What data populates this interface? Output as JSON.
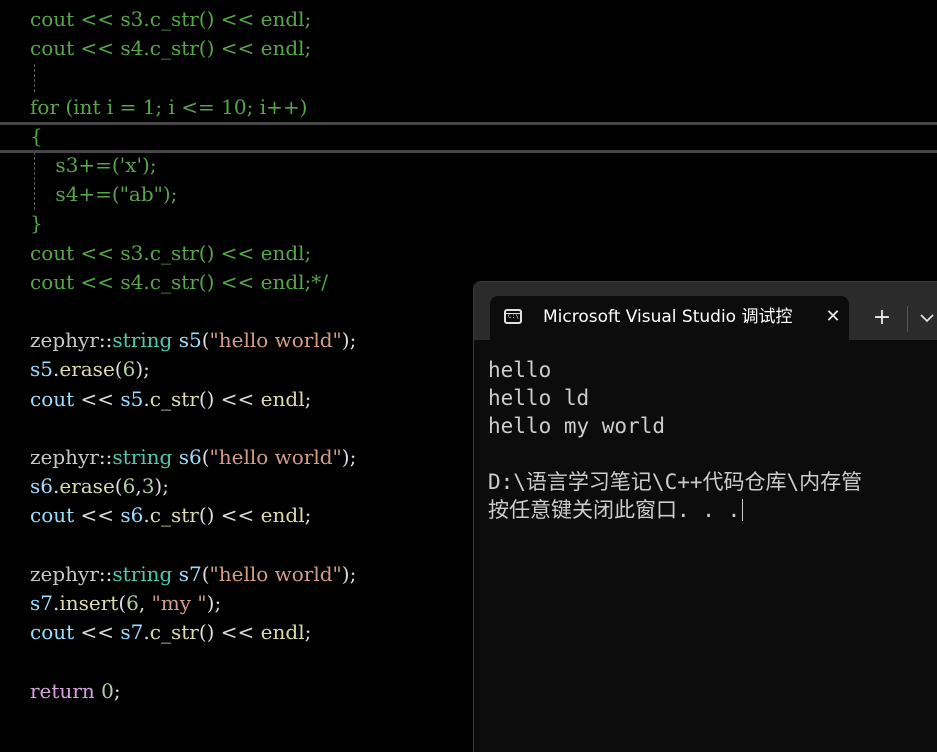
{
  "editor": {
    "lines": [
      {
        "segments": [
          {
            "text": "cout << s3.c_str() << endl;",
            "cls": ""
          }
        ]
      },
      {
        "segments": [
          {
            "text": "cout << s4.c_str() << endl;",
            "cls": ""
          }
        ]
      },
      {
        "segments": [
          {
            "text": "",
            "cls": ""
          }
        ]
      },
      {
        "segments": [
          {
            "text": "for (int i = 1; i <= 10; i++)",
            "cls": ""
          }
        ]
      },
      {
        "segments": [
          {
            "text": "{",
            "cls": ""
          }
        ]
      },
      {
        "segments": [
          {
            "text": "    s3+=('x');",
            "cls": ""
          }
        ]
      },
      {
        "segments": [
          {
            "text": "    s4+=(\"ab\");",
            "cls": ""
          }
        ]
      },
      {
        "segments": [
          {
            "text": "}",
            "cls": ""
          }
        ]
      },
      {
        "segments": [
          {
            "text": "cout << s3.c_str() << endl;",
            "cls": ""
          }
        ]
      },
      {
        "segments": [
          {
            "text": "cout << s4.c_str() << endl;*/",
            "cls": ""
          }
        ]
      },
      {
        "segments": [
          {
            "text": "",
            "cls": ""
          }
        ]
      },
      {
        "segments": [
          {
            "text": "zephyr",
            "cls": "tk-ns"
          },
          {
            "text": "::",
            "cls": "tk-plain"
          },
          {
            "text": "string",
            "cls": "tk-type"
          },
          {
            "text": " ",
            "cls": "tk-plain"
          },
          {
            "text": "s5",
            "cls": "tk-var"
          },
          {
            "text": "(",
            "cls": "tk-plain"
          },
          {
            "text": "\"hello world\"",
            "cls": "tk-str"
          },
          {
            "text": ");",
            "cls": "tk-plain"
          }
        ]
      },
      {
        "segments": [
          {
            "text": "s5",
            "cls": "tk-var"
          },
          {
            "text": ".",
            "cls": "tk-plain"
          },
          {
            "text": "erase",
            "cls": "tk-fn"
          },
          {
            "text": "(",
            "cls": "tk-plain"
          },
          {
            "text": "6",
            "cls": "tk-num"
          },
          {
            "text": ");",
            "cls": "tk-plain"
          }
        ]
      },
      {
        "segments": [
          {
            "text": "cout",
            "cls": "tk-var"
          },
          {
            "text": " << ",
            "cls": "tk-plain"
          },
          {
            "text": "s5",
            "cls": "tk-var"
          },
          {
            "text": ".",
            "cls": "tk-plain"
          },
          {
            "text": "c_str",
            "cls": "tk-fn"
          },
          {
            "text": "() << ",
            "cls": "tk-plain"
          },
          {
            "text": "endl",
            "cls": "tk-fn"
          },
          {
            "text": ";",
            "cls": "tk-plain"
          }
        ]
      },
      {
        "segments": [
          {
            "text": "",
            "cls": ""
          }
        ]
      },
      {
        "segments": [
          {
            "text": "zephyr",
            "cls": "tk-ns"
          },
          {
            "text": "::",
            "cls": "tk-plain"
          },
          {
            "text": "string",
            "cls": "tk-type"
          },
          {
            "text": " ",
            "cls": "tk-plain"
          },
          {
            "text": "s6",
            "cls": "tk-var"
          },
          {
            "text": "(",
            "cls": "tk-plain"
          },
          {
            "text": "\"hello world\"",
            "cls": "tk-str"
          },
          {
            "text": ");",
            "cls": "tk-plain"
          }
        ]
      },
      {
        "segments": [
          {
            "text": "s6",
            "cls": "tk-var"
          },
          {
            "text": ".",
            "cls": "tk-plain"
          },
          {
            "text": "erase",
            "cls": "tk-fn"
          },
          {
            "text": "(",
            "cls": "tk-plain"
          },
          {
            "text": "6",
            "cls": "tk-num"
          },
          {
            "text": ",",
            "cls": "tk-plain"
          },
          {
            "text": "3",
            "cls": "tk-num"
          },
          {
            "text": ");",
            "cls": "tk-plain"
          }
        ]
      },
      {
        "segments": [
          {
            "text": "cout",
            "cls": "tk-var"
          },
          {
            "text": " << ",
            "cls": "tk-plain"
          },
          {
            "text": "s6",
            "cls": "tk-var"
          },
          {
            "text": ".",
            "cls": "tk-plain"
          },
          {
            "text": "c_str",
            "cls": "tk-fn"
          },
          {
            "text": "() << ",
            "cls": "tk-plain"
          },
          {
            "text": "endl",
            "cls": "tk-fn"
          },
          {
            "text": ";",
            "cls": "tk-plain"
          }
        ]
      },
      {
        "segments": [
          {
            "text": "",
            "cls": ""
          }
        ]
      },
      {
        "segments": [
          {
            "text": "zephyr",
            "cls": "tk-ns"
          },
          {
            "text": "::",
            "cls": "tk-plain"
          },
          {
            "text": "string",
            "cls": "tk-type"
          },
          {
            "text": " ",
            "cls": "tk-plain"
          },
          {
            "text": "s7",
            "cls": "tk-var"
          },
          {
            "text": "(",
            "cls": "tk-plain"
          },
          {
            "text": "\"hello world\"",
            "cls": "tk-str"
          },
          {
            "text": ");",
            "cls": "tk-plain"
          }
        ]
      },
      {
        "segments": [
          {
            "text": "s7",
            "cls": "tk-var"
          },
          {
            "text": ".",
            "cls": "tk-plain"
          },
          {
            "text": "insert",
            "cls": "tk-fn"
          },
          {
            "text": "(",
            "cls": "tk-plain"
          },
          {
            "text": "6",
            "cls": "tk-num"
          },
          {
            "text": ", ",
            "cls": "tk-plain"
          },
          {
            "text": "\"my \"",
            "cls": "tk-str"
          },
          {
            "text": ");",
            "cls": "tk-plain"
          }
        ]
      },
      {
        "segments": [
          {
            "text": "cout",
            "cls": "tk-var"
          },
          {
            "text": " << ",
            "cls": "tk-plain"
          },
          {
            "text": "s7",
            "cls": "tk-var"
          },
          {
            "text": ".",
            "cls": "tk-plain"
          },
          {
            "text": "c_str",
            "cls": "tk-fn"
          },
          {
            "text": "() << ",
            "cls": "tk-plain"
          },
          {
            "text": "endl",
            "cls": "tk-fn"
          },
          {
            "text": ";",
            "cls": "tk-plain"
          }
        ]
      },
      {
        "segments": [
          {
            "text": "",
            "cls": ""
          }
        ]
      },
      {
        "segments": [
          {
            "text": "return",
            "cls": "tk-kw"
          },
          {
            "text": " ",
            "cls": "tk-plain"
          },
          {
            "text": "0",
            "cls": "tk-num"
          },
          {
            "text": ";",
            "cls": "tk-plain"
          }
        ]
      }
    ]
  },
  "console": {
    "tab_title": "Microsoft Visual Studio 调试控",
    "tab_icon_text": "C:\\",
    "close_glyph": "✕",
    "add_glyph": "+",
    "output_lines": [
      "hello",
      "hello ld",
      "hello my world",
      "",
      "D:\\语言学习笔记\\C++代码仓库\\内存管",
      "按任意键关闭此窗口. . ."
    ]
  },
  "colors": {
    "comment": "#57a64a",
    "keyword": "#d8a0df",
    "type": "#4ec9b0",
    "variable": "#9cdcfe",
    "function": "#dcdcaa",
    "string": "#d69d85",
    "number": "#b5cea8",
    "console_bg": "#0c0c0c",
    "tab_strip_bg": "#2b2b2b"
  }
}
